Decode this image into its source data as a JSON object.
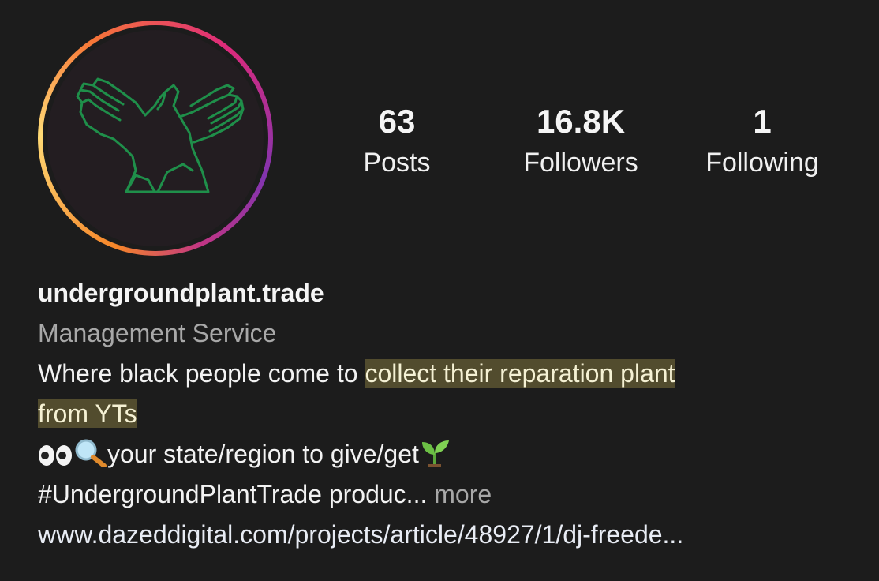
{
  "profile": {
    "username": "undergroundplant.trade",
    "category": "Management Service"
  },
  "stats": {
    "posts_count": "63",
    "posts_label": "Posts",
    "followers_count": "16.8K",
    "followers_label": "Followers",
    "following_count": "1",
    "following_label": "Following"
  },
  "bio": {
    "line1_plain": "Where black people come to ",
    "line1_highlight": "collect their reparation plant",
    "line2_highlight": "from YTs",
    "line3_text": "your state/region to give/get",
    "line3_icons": [
      "eyes-icon",
      "magnifying-glass-icon",
      "seedling-icon"
    ],
    "line4_text": "#UndergroundPlantTrade produc...",
    "more_label": " more",
    "website": "www.dazeddigital.com/projects/article/48927/1/dj-freede..."
  },
  "colors": {
    "background": "#1c1c1c",
    "highlight": "#524c2e",
    "logo_green": "#1f8f4a",
    "secondary_text": "#a8a8a8"
  }
}
